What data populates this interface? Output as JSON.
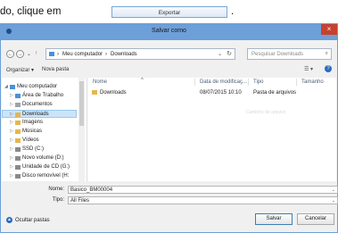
{
  "intro": {
    "text": "do, clique em",
    "button_label": "Exportar",
    "period": "."
  },
  "dialog": {
    "title": "Salvar como",
    "close_glyph": "×",
    "nav": {
      "back": "←",
      "forward": "→",
      "dropdown": "⌄",
      "up": "↑"
    },
    "address": {
      "segments": [
        "Meu computador",
        "›",
        "Downloads"
      ],
      "lead": "›",
      "dropdown": "⌄",
      "refresh": "↻"
    },
    "search": {
      "placeholder": "Pesquisar Downloads",
      "icon": "⌕"
    },
    "toolbar": {
      "organize": "Organizar ▾",
      "new_folder": "Nova pasta",
      "view": "☰ ▾",
      "help": "?"
    },
    "tree": [
      {
        "label": "Meu computador",
        "expander": "◢",
        "icon": "computer-icon",
        "color": "#4a90d9"
      },
      {
        "label": "Área de Trabalho",
        "expander": "▷",
        "icon": "desktop-icon",
        "color": "#4a90d9"
      },
      {
        "label": "Documentos",
        "expander": "▷",
        "icon": "documents-icon",
        "color": "#9aa3ad"
      },
      {
        "label": "Downloads",
        "expander": "▷",
        "icon": "downloads-icon",
        "color": "#e6b64c"
      },
      {
        "label": "Imagens",
        "expander": "▷",
        "icon": "pictures-icon",
        "color": "#e6b64c"
      },
      {
        "label": "Músicas",
        "expander": "▷",
        "icon": "music-icon",
        "color": "#e6b64c"
      },
      {
        "label": "Vídeos",
        "expander": "▷",
        "icon": "videos-icon",
        "color": "#e6b64c"
      },
      {
        "label": "SSD (C:)",
        "expander": "▷",
        "icon": "drive-icon",
        "color": "#8a8a8a"
      },
      {
        "label": "Novo volume (D:)",
        "expander": "▷",
        "icon": "drive-icon",
        "color": "#8a8a8a"
      },
      {
        "label": "Unidade de CD (G:)",
        "expander": "▷",
        "icon": "cd-drive-icon",
        "color": "#8a8a8a"
      },
      {
        "label": "Disco removível (H:",
        "expander": "▷",
        "icon": "removable-drive-icon",
        "color": "#8a8a8a"
      }
    ],
    "columns": {
      "name": "Nome",
      "sort": "^",
      "date": "Data de modificaç...",
      "type": "Tipo",
      "size": "Tamanho"
    },
    "files": [
      {
        "name": "Downloads",
        "date": "08/07/2015 10:10",
        "type": "Pasta de arquivos"
      }
    ],
    "ghost_text": "Caminho de arquivo",
    "form": {
      "name_label": "Nome:",
      "name_value": "Basico_BM00004",
      "type_label": "Tipo:",
      "type_value": "All Files",
      "dropdown": "⌄",
      "hide_folders": "Ocultar pastas",
      "hide_icon": "▲",
      "save": "Salvar",
      "cancel": "Cancelar"
    }
  },
  "colors": {
    "titlebar": "#6d9fd8",
    "close": "#c7412f",
    "selection": "#cce4f7",
    "folder": "#e6b64c"
  }
}
